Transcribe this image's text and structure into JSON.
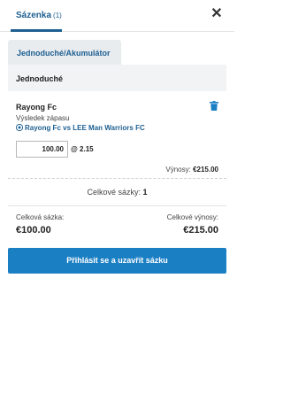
{
  "header": {
    "title": "Sázenka",
    "count": "(1)",
    "close_icon": "close-icon"
  },
  "tabs": [
    {
      "label": "Jednoduché/Akumulátor",
      "active": true
    }
  ],
  "section": {
    "title": "Jednoduché"
  },
  "bet": {
    "selection": "Rayong Fc",
    "market": "Výsledek zápasu",
    "event": "Rayong Fc vs LEE Man Warriors FC",
    "stake": "100.00",
    "odds": "@ 2.15",
    "returns_label": "Výnosy:",
    "returns_value": "€215.00",
    "delete_icon": "trash-icon",
    "sport_icon": "football-icon"
  },
  "totals": {
    "total_bets_label": "Celkové sázky:",
    "total_bets_value": "1",
    "total_stake_label": "Celková sázka:",
    "total_stake_value": "€100.00",
    "total_returns_label": "Celkové výnosy:",
    "total_returns_value": "€215.00"
  },
  "actions": {
    "submit_label": "Přihlásit se a uzavřít sázku"
  },
  "colors": {
    "accent": "#1d5f91",
    "button": "#1b7fc4"
  }
}
